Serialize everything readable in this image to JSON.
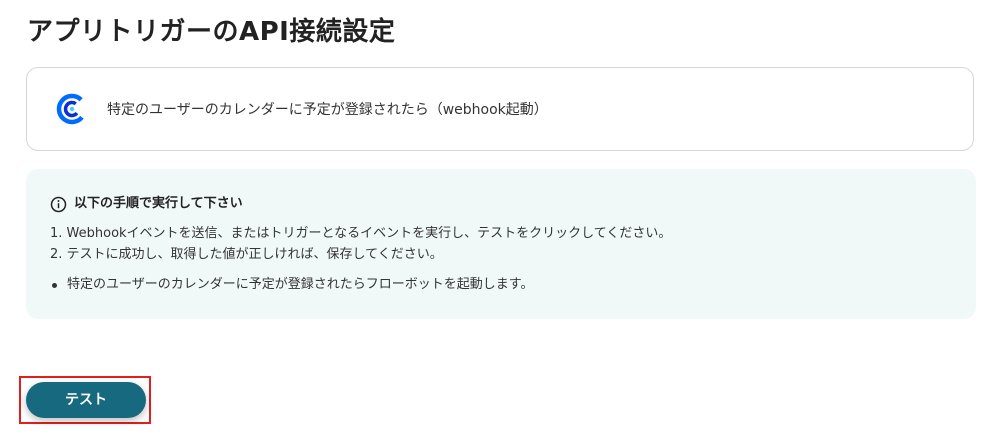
{
  "page": {
    "title": "アプリトリガーのAPI接続設定"
  },
  "trigger": {
    "app_icon": "calendly-icon",
    "description": "特定のユーザーのカレンダーに予定が登録されたら（webhook起動）"
  },
  "instructions": {
    "icon": "info-icon",
    "heading": "以下の手順で実行して下さい",
    "steps": [
      "1. Webhookイベントを送信、またはトリガーとなるイベントを実行し、テストをクリックしてください。",
      "2. テストに成功し、取得した値が正しければ、保存してください。"
    ],
    "bullets": [
      "特定のユーザーのカレンダーに予定が登録されたらフローボットを起動します。"
    ]
  },
  "actions": {
    "test_label": "テスト"
  },
  "colors": {
    "button": "#16697f",
    "info_background": "#f1f9f8",
    "highlight": "#e0201e",
    "calendly_blue": "#006bff"
  }
}
